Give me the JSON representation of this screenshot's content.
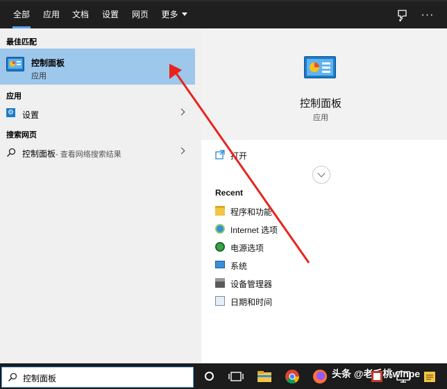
{
  "tabs": [
    {
      "label": "全部",
      "active": true
    },
    {
      "label": "应用"
    },
    {
      "label": "文档"
    },
    {
      "label": "设置"
    },
    {
      "label": "网页"
    },
    {
      "label": "更多"
    }
  ],
  "top_icons": [
    "feedback-icon",
    "more-options-icon"
  ],
  "left": {
    "best_match_header": "最佳匹配",
    "best_match": {
      "title": "控制面板",
      "subtitle": "应用"
    },
    "apps_header": "应用",
    "apps": [
      {
        "label": "设置"
      }
    ],
    "web_header": "搜索网页",
    "web": {
      "label": "控制面板",
      "suffix": " - 查看网络搜索结果"
    }
  },
  "right": {
    "title": "控制面板",
    "subtitle": "应用",
    "open_label": "打开",
    "recent_header": "Recent",
    "recent": [
      {
        "label": "程序和功能",
        "icon": "folder-icon"
      },
      {
        "label": "Internet 选项",
        "icon": "internet-options-icon"
      },
      {
        "label": "电源选项",
        "icon": "power-options-icon"
      },
      {
        "label": "系统",
        "icon": "system-icon"
      },
      {
        "label": "设备管理器",
        "icon": "device-manager-icon"
      },
      {
        "label": "日期和时间",
        "icon": "date-time-icon"
      }
    ]
  },
  "taskbar": {
    "search_value": "控制面板",
    "watermark": "头条 @老毛桃winpe"
  },
  "colors": {
    "accent": "#5ba3ec",
    "selected_row": "#9dc7eb",
    "annotation_arrow": "#e8231c"
  }
}
